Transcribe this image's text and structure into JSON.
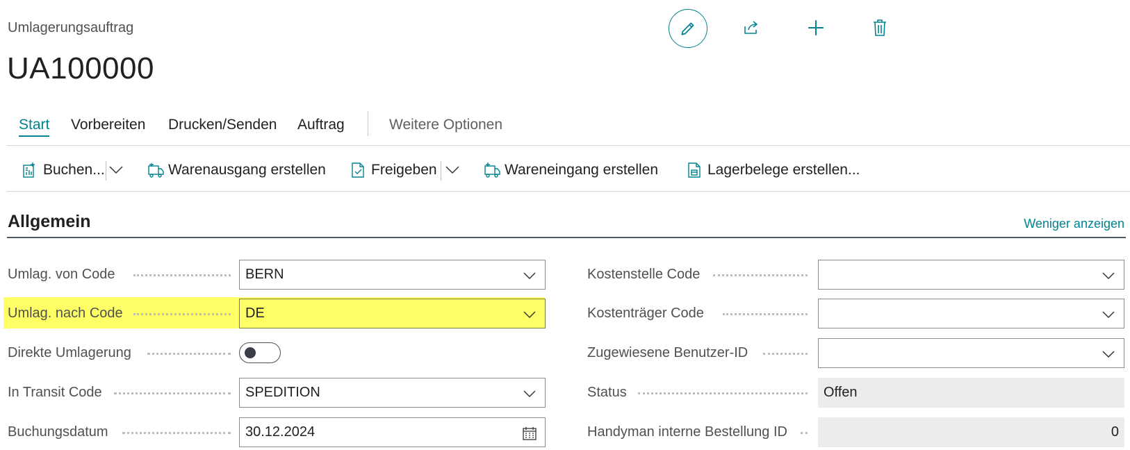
{
  "header": {
    "caption": "Umlagerungsauftrag",
    "title": "UA100000",
    "icons": [
      "pencil-icon",
      "share-icon",
      "plus-icon",
      "trash-icon"
    ]
  },
  "tabs": [
    {
      "label": "Start",
      "active": true
    },
    {
      "label": "Vorbereiten"
    },
    {
      "label": "Drucken/Senden"
    },
    {
      "label": "Auftrag"
    },
    {
      "label": "Weitere Optionen"
    }
  ],
  "actions": [
    {
      "label": "Buchen...",
      "icon": "post-icon"
    },
    {
      "label": "Warenausgang erstellen",
      "icon": "shipment-icon"
    },
    {
      "label": "Freigeben",
      "icon": "release-icon"
    },
    {
      "label": "Wareneingang erstellen",
      "icon": "receipt-icon"
    },
    {
      "label": "Lagerbelege erstellen...",
      "icon": "warehouse-docs-icon"
    }
  ],
  "section": {
    "title": "Allgemein",
    "toggle_link": "Weniger anzeigen"
  },
  "left_fields": [
    {
      "label": "Umlag. von Code",
      "value": "BERN"
    },
    {
      "label": "Umlag. nach Code",
      "value": "DE"
    },
    {
      "label": "Direkte Umlagerung",
      "value": "off"
    },
    {
      "label": "In Transit Code",
      "value": "SPEDITION"
    },
    {
      "label": "Buchungsdatum",
      "value": "30.12.2024"
    }
  ],
  "right_fields": [
    {
      "label": "Kostenstelle Code",
      "value": ""
    },
    {
      "label": "Kostenträger Code",
      "value": ""
    },
    {
      "label": "Zugewiesene Benutzer-ID",
      "value": ""
    },
    {
      "label": "Status",
      "value": "Offen"
    },
    {
      "label": "Handyman interne Bestellung ID",
      "value": "0"
    }
  ],
  "colors": {
    "accent": "#00838f",
    "highlight": "#ffff66"
  }
}
